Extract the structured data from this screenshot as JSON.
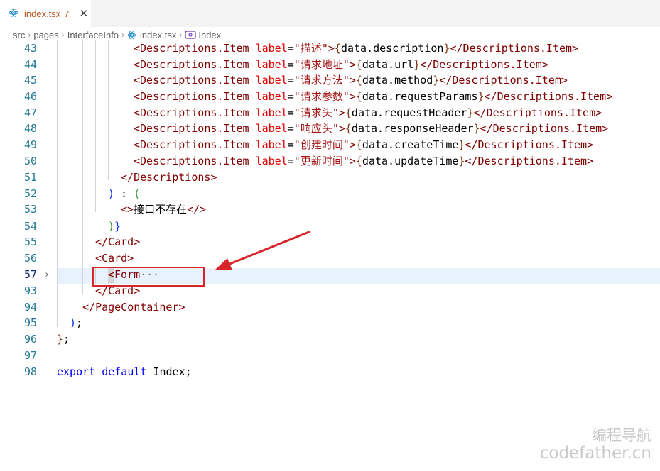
{
  "tab": {
    "icon": "react-icon",
    "filename": "index.tsx",
    "problems": "7",
    "close": "✕"
  },
  "breadcrumbs": [
    {
      "label": "src"
    },
    {
      "label": "pages"
    },
    {
      "label": "InterfaceInfo"
    },
    {
      "label": "index.tsx",
      "icon": "react-icon"
    },
    {
      "label": "Index",
      "icon": "symbol-icon"
    }
  ],
  "colors": {
    "tag": "#800000",
    "attribute": "#e50000",
    "string": "#a31515",
    "bracket_level1": "#0431fa",
    "bracket_level2": "#319331",
    "bracket_level3": "#7b3814",
    "keyword": "#0000ff",
    "line_number": "#237893",
    "current_line": "#e8f2ff",
    "annotation": "#d9252a"
  },
  "lines": [
    {
      "num": "43",
      "label": "描述",
      "expr": "data.description"
    },
    {
      "num": "44",
      "label": "请求地址",
      "expr": "data.url"
    },
    {
      "num": "45",
      "label": "请求方法",
      "expr": "data.method"
    },
    {
      "num": "46",
      "label": "请求参数",
      "expr": "data.requestParams"
    },
    {
      "num": "47",
      "label": "请求头",
      "expr": "data.requestHeader"
    },
    {
      "num": "48",
      "label": "响应头",
      "expr": "data.responseHeader"
    },
    {
      "num": "49",
      "label": "创建时间",
      "expr": "data.createTime"
    },
    {
      "num": "50",
      "label": "更新时间",
      "expr": "data.updateTime"
    },
    {
      "num": "51"
    },
    {
      "num": "52"
    },
    {
      "num": "53",
      "text": "接口不存在"
    },
    {
      "num": "54"
    },
    {
      "num": "55"
    },
    {
      "num": "56"
    },
    {
      "num": "57"
    },
    {
      "num": "93"
    },
    {
      "num": "94"
    },
    {
      "num": "95"
    },
    {
      "num": "96"
    },
    {
      "num": "97"
    },
    {
      "num": "98",
      "kw1": "export",
      "kw2": "default",
      "ident": "Index"
    }
  ],
  "tokens": {
    "desc_item": "Descriptions.Item",
    "label_attr": "label",
    "descriptions": "Descriptions",
    "card": "Card",
    "form": "Form",
    "page_container": "PageContainer",
    "ellipsis": "···"
  },
  "watermark": {
    "line1": "编程导航",
    "line2": "codefather.cn"
  }
}
